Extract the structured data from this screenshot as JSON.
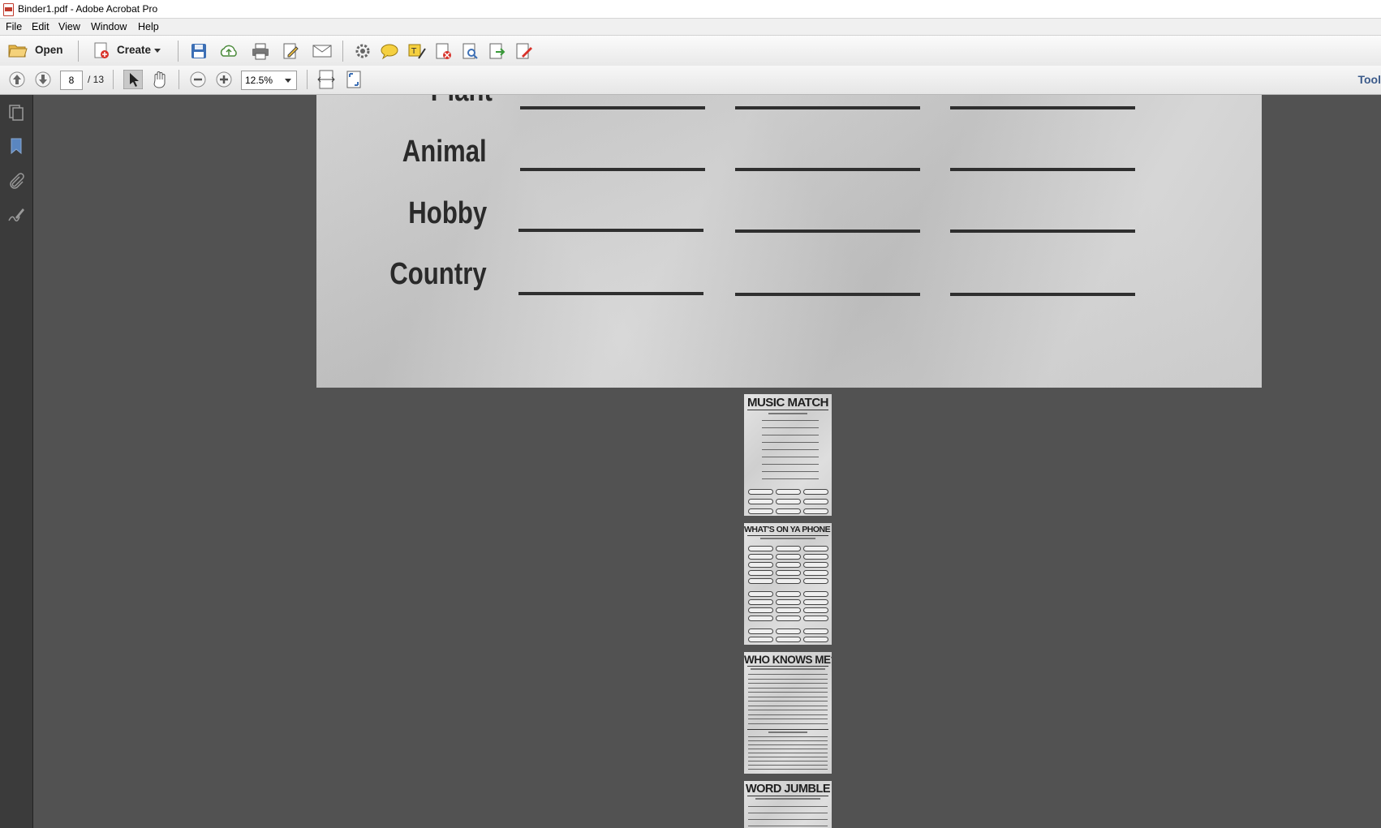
{
  "window": {
    "title": "Binder1.pdf - Adobe Acrobat Pro"
  },
  "menu": [
    "File",
    "Edit",
    "View",
    "Window",
    "Help"
  ],
  "toolbar": {
    "open_label": "Open",
    "create_label": "Create"
  },
  "navigation": {
    "current_page": "8",
    "total_pages": "/ 13",
    "zoom": "12.5%"
  },
  "tools_label": "Tool",
  "document": {
    "rows": [
      "Plant",
      "Animal",
      "Hobby",
      "Country"
    ]
  },
  "thumbnails": [
    {
      "title": "MUSIC MATCH"
    },
    {
      "title": "WHAT'S ON YA PHONE ?"
    },
    {
      "title": "WHO KNOWS ME?"
    },
    {
      "title": "WORD JUMBLE"
    }
  ],
  "colors": {
    "workspace": "#525252",
    "nav_panel": "#3b3b3b",
    "tools_link": "#3b5a8a"
  }
}
